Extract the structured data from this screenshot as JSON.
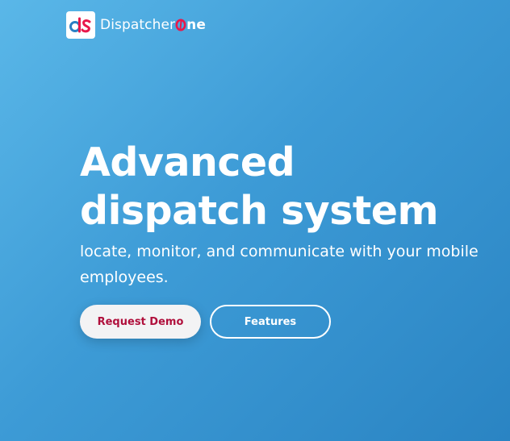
{
  "brand": {
    "name_prefix": "Dispatcher",
    "name_suffix": "ne",
    "mark_text": "ds",
    "colors": {
      "red": "#e8184a",
      "blue": "#2a7fc4"
    }
  },
  "hero": {
    "title_line1": "Advanced",
    "title_line2": "dispatch system",
    "subtitle": "locate, monitor, and communicate with your mobile employees."
  },
  "buttons": {
    "request_demo": "Request Demo",
    "features": "Features"
  },
  "colors": {
    "background_start": "#5ab7e8",
    "background_end": "#2a84c3",
    "demo_text": "#b0103c"
  }
}
